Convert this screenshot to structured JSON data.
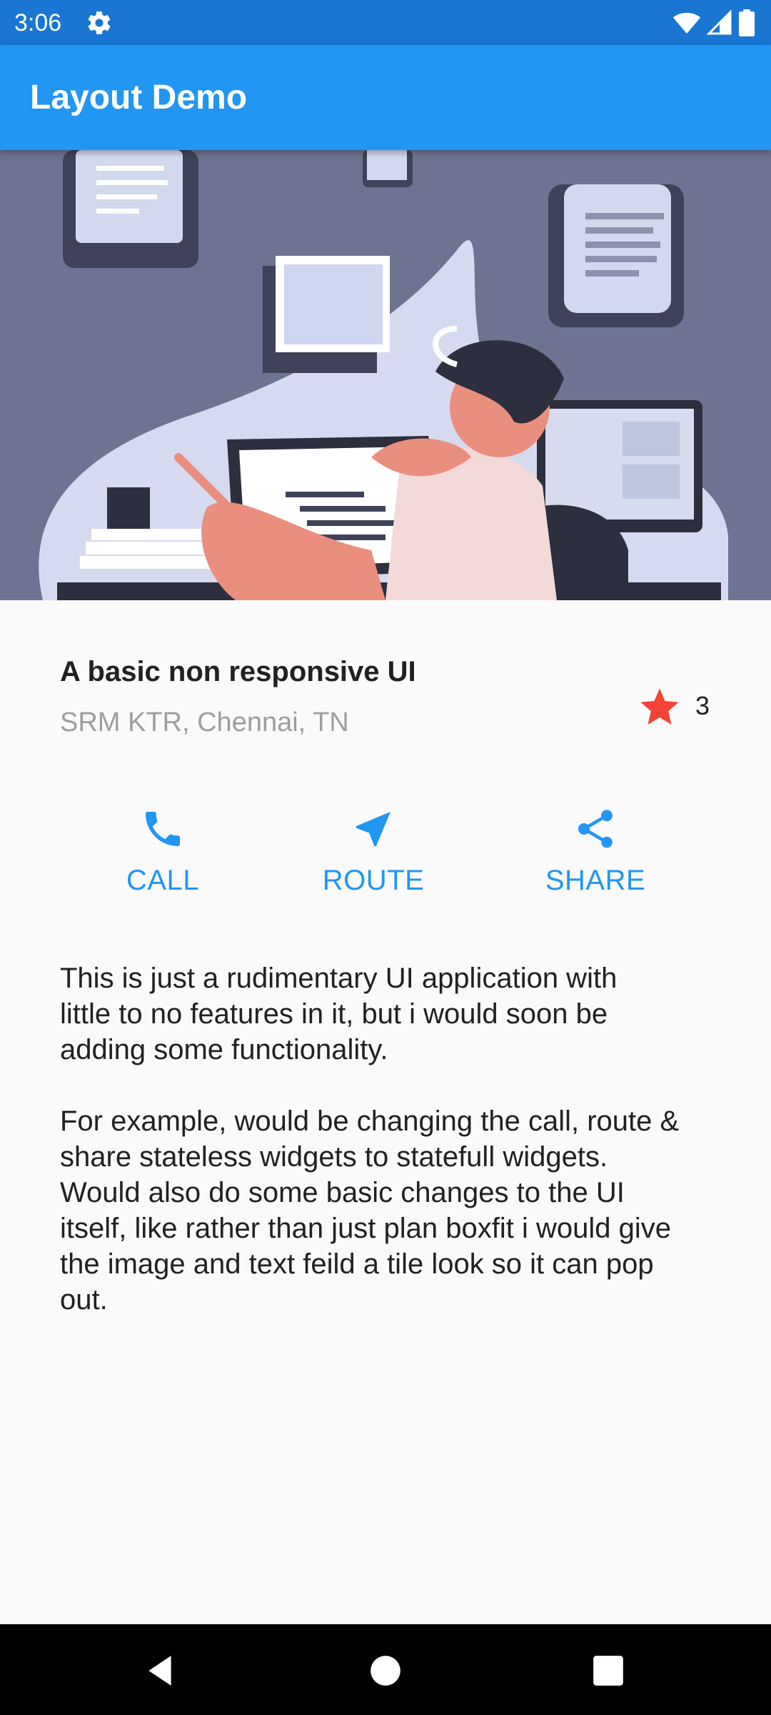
{
  "status_bar": {
    "time": "3:06",
    "icons": [
      "gear-icon",
      "wifi-icon",
      "signal-icon",
      "battery-icon"
    ],
    "color": "#1976d2"
  },
  "app_bar": {
    "title": "Layout Demo",
    "color": "#2196f3"
  },
  "hero": {
    "description": "Illustration of a person working at a desk with a laptop and monitors"
  },
  "title_section": {
    "headline": "A basic non responsive UI",
    "location": "SRM KTR, Chennai, TN",
    "star_icon": "star-icon",
    "star_color": "#f44336",
    "rating_count": "3"
  },
  "actions": [
    {
      "icon": "phone-icon",
      "label": "CALL"
    },
    {
      "icon": "navigation-icon",
      "label": "ROUTE"
    },
    {
      "icon": "share-icon",
      "label": "SHARE"
    }
  ],
  "description": {
    "paragraph1": "This is just a rudimentary UI application with\nlittle to no  features in it, but i would soon be\nadding some functionality.",
    "paragraph2": "For example, would be changing the call, route  &\nshare stateless widgets to statefull widgets.\nWould also do some basic changes to the UI\nitself, like rather than just plan boxfit i would give\nthe image and text feild a tile look so it can pop\nout."
  },
  "nav_bar": {
    "buttons": [
      "back-icon",
      "home-icon",
      "recents-icon"
    ]
  },
  "accent_color": "#2196f3"
}
